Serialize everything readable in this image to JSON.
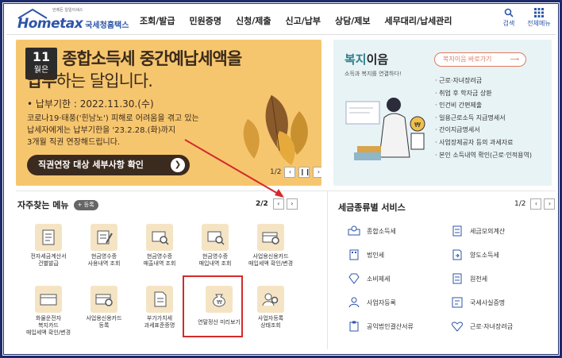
{
  "header": {
    "brand": "Hometax",
    "brand_kor": "국세청홈택스",
    "tagline": "언제든 일일이세스",
    "nav": [
      "조회/발급",
      "민원증명",
      "신청/제출",
      "신고/납부",
      "상담/제보",
      "세무대리/납세관리"
    ],
    "search_label": "검색",
    "menu_label": "전체메뉴"
  },
  "banner": {
    "day": "11",
    "month_label": "월은",
    "headline": "종합소득세 중간예납세액을",
    "headline2_bold": "납부",
    "headline2_rest": "하는 달입니다.",
    "deadline": "• 납부기한 : 2022.11.30.(수)",
    "note_lines": [
      "코로나19·태풍('힌남노') 피해로 어려움을 겪고 있는",
      "납세자에게는 납부기한을 '23.2.28.(화)까지",
      "3개월 직권 연장해드립니다."
    ],
    "cta": "직권연장 대상 세부사항 확인",
    "pager": "1/2"
  },
  "welfare": {
    "title_accent": "복지",
    "title_rest": "이음",
    "subtitle": "소득과 복지를 연결하다!",
    "more": "복지이음 바로가기",
    "items": [
      "근로·자녀장려금",
      "취업 후 학자금 상환",
      "인건비 간편제출",
      "일용근로소득 지급명세서",
      "간이지급명세서",
      "사업장제공자 등의 과세자료",
      "본인 소득내역 확인(근로·인적용역)"
    ]
  },
  "favorites": {
    "title": "자주찾는 메뉴",
    "add_label": "+ 등록",
    "pager": "2/2",
    "items": [
      {
        "l1": "전자세금계산서",
        "l2": "건별발급",
        "l3": ""
      },
      {
        "l1": "현금영수증",
        "l2": "사용내역 조회",
        "l3": ""
      },
      {
        "l1": "현금영수증",
        "l2": "매출내역 조회",
        "l3": ""
      },
      {
        "l1": "현금영수증",
        "l2": "매입내역 조회",
        "l3": ""
      },
      {
        "l1": "사업용신용카드",
        "l2": "매입세액 확인/변경",
        "l3": ""
      },
      {
        "l1": "화물운전자",
        "l2": "복지카드",
        "l3": "매입세액 확인/변경"
      },
      {
        "l1": "사업용신용카드",
        "l2": "등록",
        "l3": ""
      },
      {
        "l1": "부가가치세",
        "l2": "과세표준증명",
        "l3": ""
      },
      {
        "l1": "연말정산 미리보기",
        "l2": "",
        "l3": ""
      },
      {
        "l1": "사업자등록",
        "l2": "상태조회",
        "l3": ""
      }
    ]
  },
  "tax_services": {
    "title": "세금종류별 서비스",
    "pager": "1/2",
    "items": [
      "종합소득세",
      "세금모의계산",
      "법인세",
      "양도소득세",
      "소비제세",
      "원천세",
      "사업자등록",
      "국세사실증명",
      "공익법인결산서류",
      "근로·자녀장려금"
    ]
  },
  "colors": {
    "banner_bg": "#f6c66f",
    "brand_blue": "#2d55a8",
    "welfare_bg": "#e8f3f6",
    "highlight_red": "#d32b2b"
  }
}
